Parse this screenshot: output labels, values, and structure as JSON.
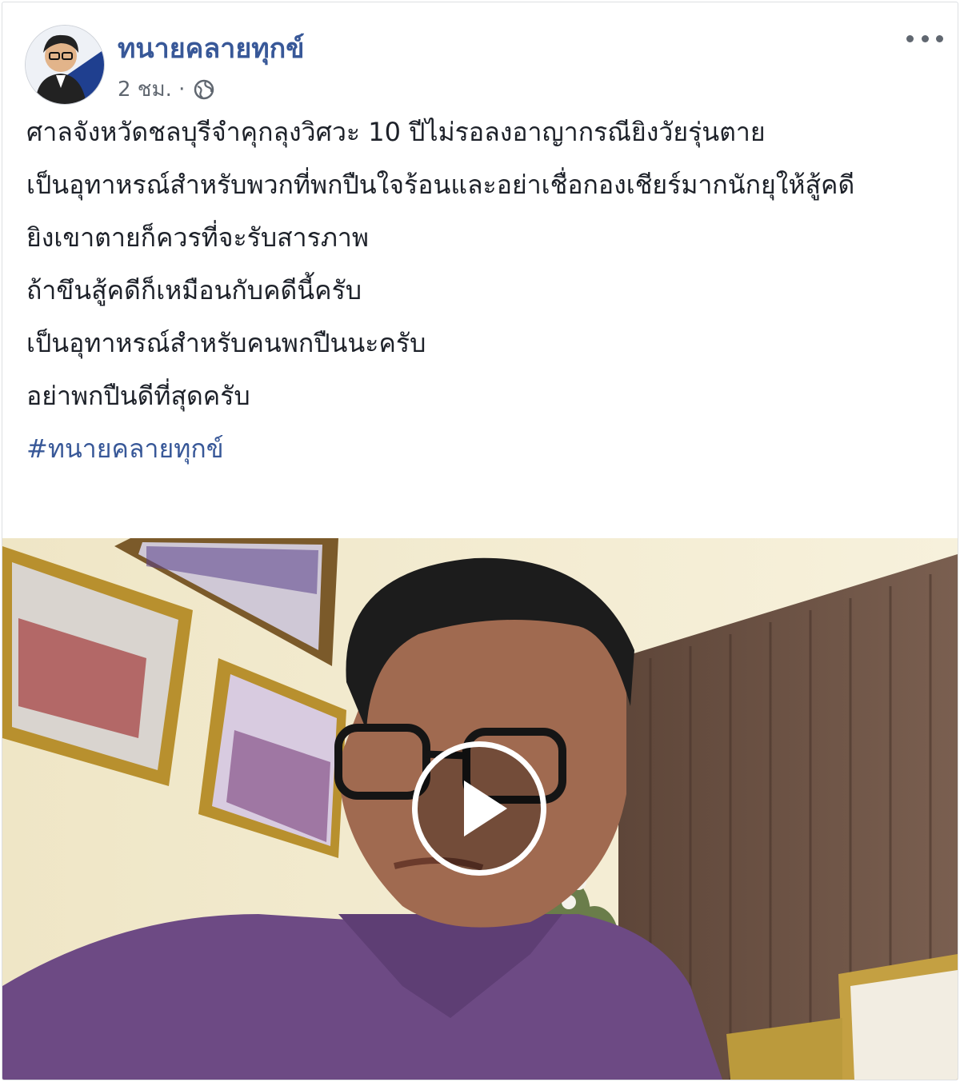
{
  "post": {
    "author": "ทนายคลายทุกข์",
    "timestamp": "2 ชม. ·",
    "privacy_icon": "globe-icon",
    "more_icon": "more-options-icon",
    "lines": [
      "ศาลจังหวัดชลบุรีจำคุกลุงวิศวะ 10 ปีไม่รอลงอาญากรณียิงวัยรุ่นตาย",
      "เป็นอุทาหรณ์สำหรับพวกที่พกปืนใจร้อนและอย่าเชื่อกองเชียร์มากนักยุให้สู้คดี",
      "ยิงเขาตายก็ควรที่จะรับสารภาพ",
      "ถ้าขึนสู้คดีก็เหมือนกับคดีนี้ครับ",
      "เป็นอุทาหรณ์สำหรับคนพกปืนนะครับ",
      "อย่าพกปืนดีที่สุดครับ"
    ],
    "hashtag": "#ทนายคลายทุกข์"
  },
  "video": {
    "play_icon": "play-icon"
  },
  "colors": {
    "link": "#385898",
    "text": "#1d2129",
    "meta": "#606770"
  }
}
